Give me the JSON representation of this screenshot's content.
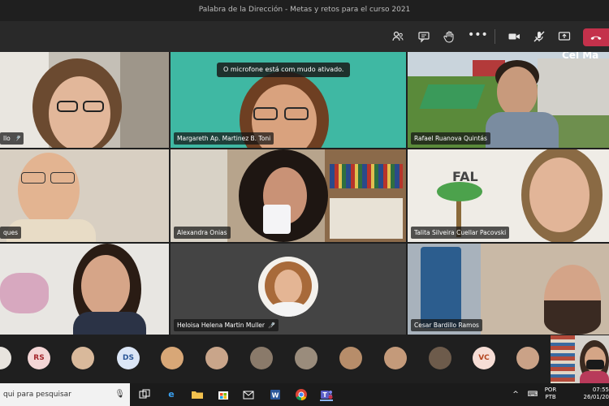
{
  "window": {
    "title": "Palabra de la Dirección - Metas y retos para el curso 2021"
  },
  "toolbar": {
    "icons": [
      "participants-icon",
      "chat-icon",
      "raise-hand-icon",
      "more-icon",
      "camera-icon",
      "mic-muted-icon",
      "share-icon",
      "hangup-icon"
    ]
  },
  "toast": {
    "text": "O microfone está com mudo ativado."
  },
  "tiles": [
    {
      "name": "llo",
      "muted": true
    },
    {
      "name": "Margareth Ap. Martinez B. Toni",
      "muted": false
    },
    {
      "name": "Rafael Ruanova Quintás",
      "muted": false
    },
    {
      "name": "ques",
      "muted": false
    },
    {
      "name": "Alexandra Onias",
      "muted": false
    },
    {
      "name": "Talita Silveira Cuellar Pacovski",
      "muted": false
    },
    {
      "name": "",
      "muted": false
    },
    {
      "name": "Heloisa Helena Martin Muller",
      "muted": true
    },
    {
      "name": "Cesar Bardillo Ramos",
      "muted": false
    }
  ],
  "tile_overlay": {
    "brand_text": "Cel Ma",
    "banner_text": "FAL"
  },
  "avatars": [
    {
      "initials": "",
      "bg": "#e8e4de"
    },
    {
      "initials": "RS",
      "bg": "#f4d6d6",
      "fg": "#a4262c"
    },
    {
      "initials": "",
      "bg": "#d9b99b"
    },
    {
      "initials": "DS",
      "bg": "#dbe6f6",
      "fg": "#2b5797"
    },
    {
      "initials": "",
      "bg": "#d8a777"
    },
    {
      "initials": "",
      "bg": "#c9a58a"
    },
    {
      "initials": "",
      "bg": "#8a7a6a"
    },
    {
      "initials": "",
      "bg": "#9a8c7c"
    },
    {
      "initials": "",
      "bg": "#b78d6a"
    },
    {
      "initials": "",
      "bg": "#c49a7a"
    },
    {
      "initials": "",
      "bg": "#6d5b4b"
    },
    {
      "initials": "VC",
      "bg": "#f6ddd5",
      "fg": "#b4451f"
    },
    {
      "initials": "",
      "bg": "#caa287"
    }
  ],
  "taskbar": {
    "search_placeholder": "qui para pesquisar",
    "lang_top": "POR",
    "lang_bottom": "PTB",
    "time": "07:55",
    "date": "26/01/20"
  }
}
